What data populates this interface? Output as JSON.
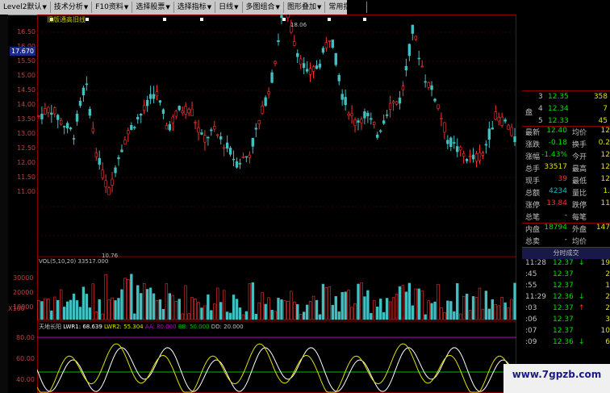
{
  "toolbar": {
    "items": [
      "Level2默认",
      "技术分析",
      "F10资料",
      "选择股票",
      "选择指标",
      "日线",
      "多图组合",
      "图形叠加",
      "常用指标"
    ]
  },
  "chart": {
    "title": "旧版通高旧线",
    "current_price": "17.670",
    "price_labels": [
      "16.50",
      "16.00",
      "15.50",
      "15.00",
      "14.50",
      "14.00",
      "13.50",
      "13.00",
      "12.50",
      "12.00",
      "11.50",
      "11.00"
    ],
    "high_label": "18.06",
    "low_label": "10.76",
    "volume_label": "VOL(5,10,20) 33517.000",
    "volume_axis": [
      "30000",
      "20000",
      "10000",
      "X100"
    ],
    "indicator_label": {
      "name": "天地长阳",
      "lwr1": "LWR1: 68.639",
      "lwr2": "LWR2: 55.304",
      "aa": "AA: 80.000",
      "bb": "BB: 50.000",
      "dd": "DD: 20.000"
    },
    "indicator_axis": [
      "80.00",
      "60.00",
      "40.00"
    ],
    "colors": {
      "up": "#ff3030",
      "down": "#40c0c0",
      "grid": "#8b0000"
    }
  },
  "orderbook": {
    "side_label": "盘",
    "rows": [
      {
        "n": "3",
        "price": "12.35",
        "vol": "358"
      },
      {
        "n": "4",
        "price": "12.34",
        "vol": "7"
      },
      {
        "n": "5",
        "price": "12.33",
        "vol": "45"
      }
    ]
  },
  "quote_rows": [
    {
      "l1": "最新",
      "v1": "12.40",
      "c1": "#00e000",
      "l2": "均价",
      "v2": "12"
    },
    {
      "l1": "涨跌",
      "v1": "-0.18",
      "c1": "#00e000",
      "l2": "换手",
      "v2": "0.2"
    },
    {
      "l1": "涨幅",
      "v1": "-1.43%",
      "c1": "#00e000",
      "l2": "今开",
      "v2": "12"
    },
    {
      "l1": "总手",
      "v1": "33517",
      "c1": "#e0e000",
      "l2": "最高",
      "v2": "12"
    },
    {
      "l1": "现手",
      "v1": "39",
      "c1": "#ff3030",
      "l2": "最低",
      "v2": "12"
    },
    {
      "l1": "总额",
      "v1": "4234",
      "c1": "#00c0c0",
      "l2": "量比",
      "v2": "1."
    },
    {
      "l1": "涨停",
      "v1": "13.84",
      "c1": "#ff3030",
      "l2": "跌停",
      "v2": "11"
    },
    {
      "l1": "总笔",
      "v1": "-",
      "c1": "#c0c0c0",
      "l2": "每笔",
      "v2": ""
    },
    {
      "l1": "内盘",
      "v1": "18794",
      "c1": "#00e000",
      "l2": "外盘",
      "v2": "147"
    },
    {
      "l1": "总卖",
      "v1": "-",
      "c1": "#c0c0c0",
      "l2": "均价",
      "v2": ""
    },
    {
      "l1": "总买",
      "v1": "-",
      "c1": "#c0c0c0",
      "l2": "均价",
      "v2": ""
    }
  ],
  "ticks": {
    "header": "分时成交",
    "rows": [
      {
        "t": "11:28",
        "p": "12.37",
        "arrow": "↓",
        "ac": "#00e000",
        "v": "19"
      },
      {
        "t": ":45",
        "p": "12.37",
        "arrow": "",
        "ac": "#00e000",
        "v": "2"
      },
      {
        "t": ":55",
        "p": "12.37",
        "arrow": "",
        "ac": "#00e000",
        "v": "1"
      },
      {
        "t": "11:29",
        "p": "12.36",
        "arrow": "↓",
        "ac": "#00e000",
        "v": "2"
      },
      {
        "t": ":03",
        "p": "12.37",
        "arrow": "↑",
        "ac": "#ff3030",
        "v": "2"
      },
      {
        "t": ":06",
        "p": "12.37",
        "arrow": "",
        "ac": "#00e000",
        "v": "3"
      },
      {
        "t": ":07",
        "p": "12.37",
        "arrow": "",
        "ac": "#00e000",
        "v": "10"
      },
      {
        "t": ":09",
        "p": "12.36",
        "arrow": "↓",
        "ac": "#00e000",
        "v": "6"
      }
    ]
  },
  "watermark": "www.7gpzb.com"
}
